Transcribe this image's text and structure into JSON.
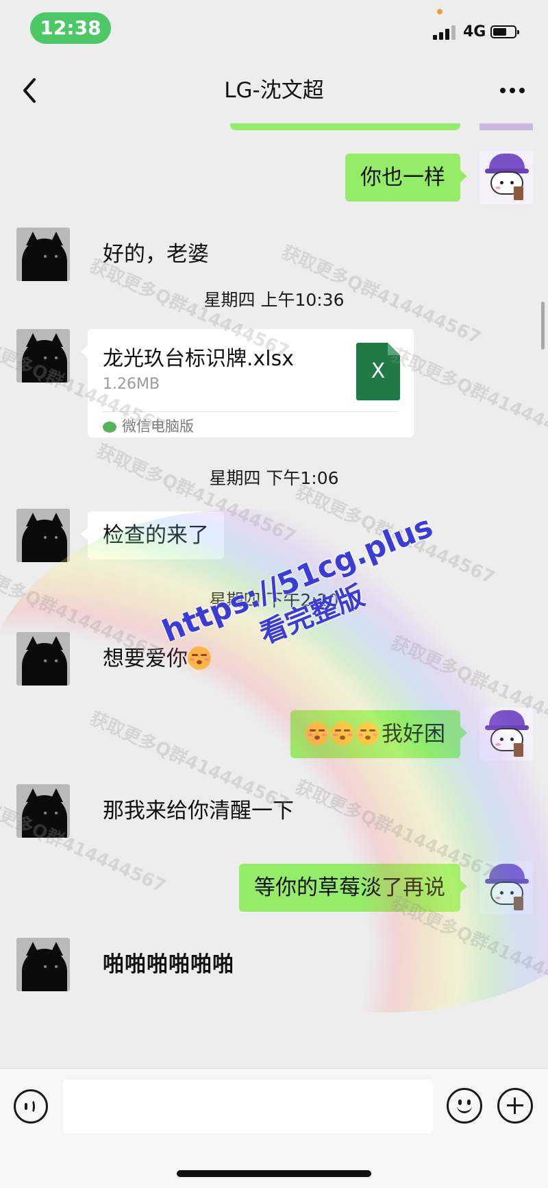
{
  "status_bar": {
    "time": "12:38",
    "network": "4G"
  },
  "nav": {
    "title": "LG-沈文超"
  },
  "messages": [
    {
      "side": "right",
      "text": "你也一样"
    },
    {
      "side": "left",
      "text": "好的，老婆"
    },
    {
      "type": "timestamp",
      "text": "星期四 上午10:36"
    },
    {
      "type": "file",
      "side": "left",
      "file_name": "龙光玖台标识牌.xlsx",
      "file_size": "1.26MB",
      "source": "微信电脑版",
      "file_badge": "X"
    },
    {
      "type": "timestamp",
      "text": "星期四 下午1:06"
    },
    {
      "side": "left",
      "text": "检查的来了"
    },
    {
      "type": "timestamp",
      "text": "星期四 下午2:20"
    },
    {
      "side": "left",
      "text": "想要爱你",
      "emoji": "smiling-face-closed-eyes-icon"
    },
    {
      "side": "right",
      "text": "我好困",
      "emoji": "kissing-face-icon"
    },
    {
      "side": "left",
      "text": "那我来给你清醒一下"
    },
    {
      "side": "right",
      "text": "等你的草莓淡了再说"
    },
    {
      "side": "left",
      "text": "啪啪啪啪啪啪"
    }
  ],
  "input_bar": {
    "placeholder": ""
  },
  "overlays": {
    "watermark": "获取更多Q群414444567",
    "promo_line1": "https://51cg.plus",
    "promo_line2": "看完整版"
  },
  "colors": {
    "sent_bubble": "#95ec69",
    "received_bubble": "#ffffff",
    "background": "#ededed",
    "time_pill": "#4cc867"
  },
  "icons": [
    "back-chevron-icon",
    "more-dots-icon",
    "voice-icon",
    "emoji-icon",
    "plus-icon",
    "excel-file-icon",
    "wechat-pc-icon"
  ]
}
